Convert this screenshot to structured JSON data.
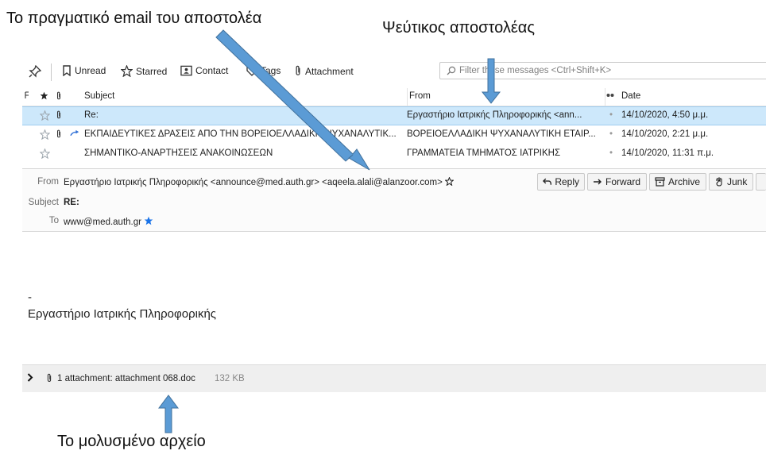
{
  "annotations": {
    "real_sender": "Το πραγματικό email του αποστολέα",
    "fake_sender": "Ψεύτικος αποστολέας",
    "infected_file": "Το μολυσμένο αρχείο"
  },
  "toolbar": {
    "unread": "Unread",
    "starred": "Starred",
    "contact": "Contact",
    "tags": "Tags",
    "attachment": "Attachment",
    "filter_placeholder": "Filter these messages <Ctrl+Shift+K>"
  },
  "columns": {
    "subject": "Subject",
    "from": "From",
    "date": "Date"
  },
  "messages": [
    {
      "subject": "Re:",
      "from": "Εργαστήριο Ιατρικής Πληροφορικής <ann...",
      "date": "14/10/2020, 4:50 μ.μ."
    },
    {
      "subject": "ΕΚΠΑΙΔΕΥΤΙΚΕΣ ΔΡΑΣΕΙΣ ΑΠΟ ΤΗΝ ΒΟΡΕΙΟΕΛΛΑΔΙΚΗ ΨΥΧΑΝΑΛΥΤΙΚ...",
      "from": "ΒΟΡΕΙΟΕΛΛΑΔΙΚΗ ΨΥΧΑΝΑΛΥΤΙΚΗ ΕΤΑΙΡ...",
      "date": "14/10/2020, 2:21 μ.μ."
    },
    {
      "subject": "ΣΗΜΑΝΤΙΚΟ-ΑΝΑΡΤΗΣΕΙΣ ΑΝΑΚΟΙΝΩΣΕΩΝ",
      "from": "ΓΡΑΜΜΑΤΕΙΑ ΤΜΗΜΑΤΟΣ ΙΑΤΡΙΚΗΣ",
      "date": "14/10/2020, 11:31 π.μ."
    }
  ],
  "header": {
    "from_label": "From",
    "from_value": "Εργαστήριο Ιατρικής Πληροφορικής <announce@med.auth.gr> <aqeela.alali@alanzoor.com>",
    "subject_label": "Subject",
    "subject_value": "RE:",
    "to_label": "To",
    "to_value": "www@med.auth.gr",
    "buttons": {
      "reply": "Reply",
      "forward": "Forward",
      "archive": "Archive",
      "junk": "Junk"
    }
  },
  "body": {
    "dash": "-",
    "signature": "Εργαστήριο Ιατρικής Πληροφορικής"
  },
  "attachment_bar": {
    "text": "1 attachment: attachment 068.doc",
    "size": "132 KB"
  },
  "colors": {
    "selected_row": "#cde8fb",
    "arrow_fill": "#5b9bd5",
    "arrow_stroke": "#41719c",
    "star_blue": "#1a73e8"
  }
}
